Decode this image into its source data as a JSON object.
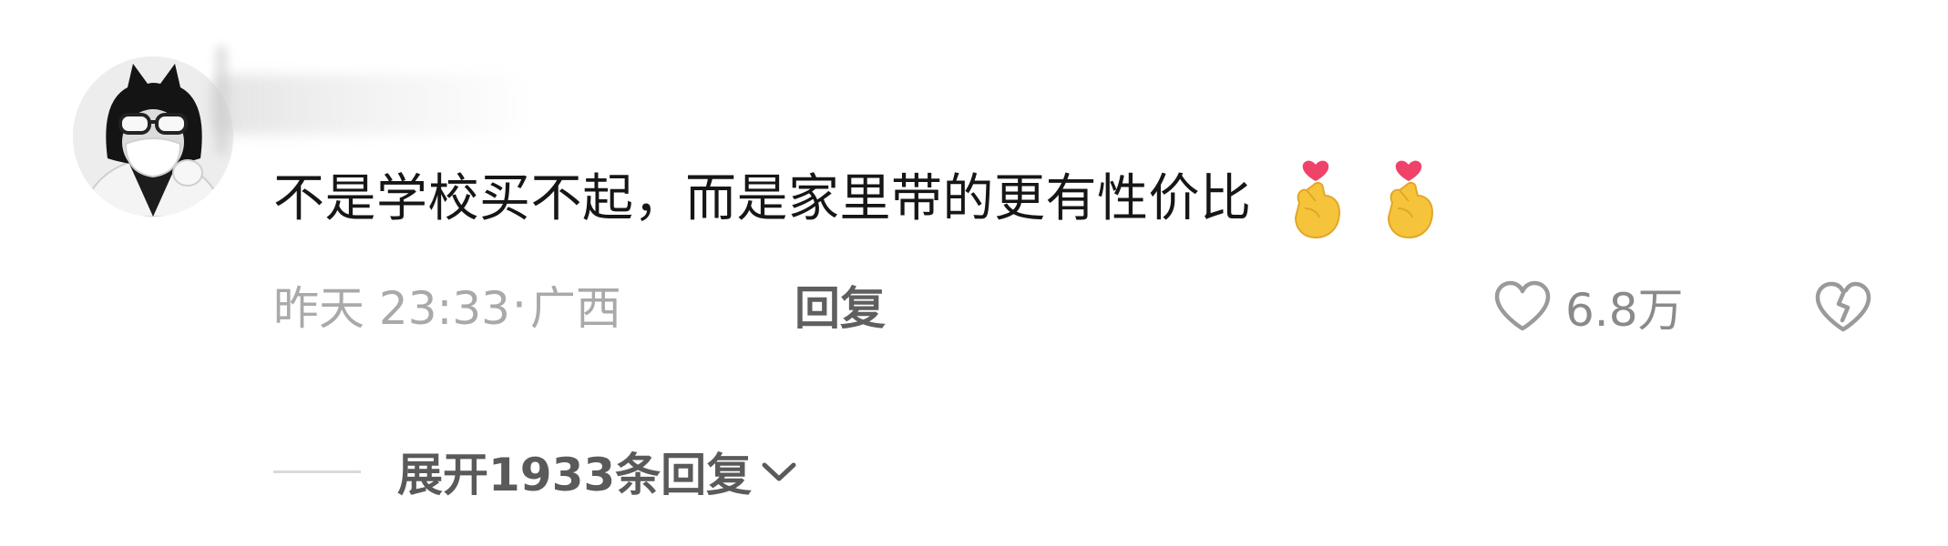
{
  "comment": {
    "avatar": {
      "icon": "user-avatar-photo"
    },
    "username": "",
    "text": "不是学校买不起，而是家里带的更有性价比",
    "emojis": [
      "finger-heart-emoji",
      "finger-heart-emoji"
    ],
    "time": "昨天 23:33",
    "separator": "·",
    "location": "广西",
    "reply_label": "回复",
    "likes": {
      "icon": "heart-outline-icon",
      "count": "6.8万"
    },
    "dislike": {
      "icon": "broken-heart-icon"
    },
    "expand": {
      "label": "展开1933条回复",
      "icon": "chevron-down-icon"
    }
  },
  "colors": {
    "text": "#161616",
    "meta": "#a9a9a9",
    "reply": "#5f5f5f",
    "icon": "#9a9a9a",
    "emoji_hand": "#f6c43a",
    "emoji_heart": "#f0436a"
  }
}
